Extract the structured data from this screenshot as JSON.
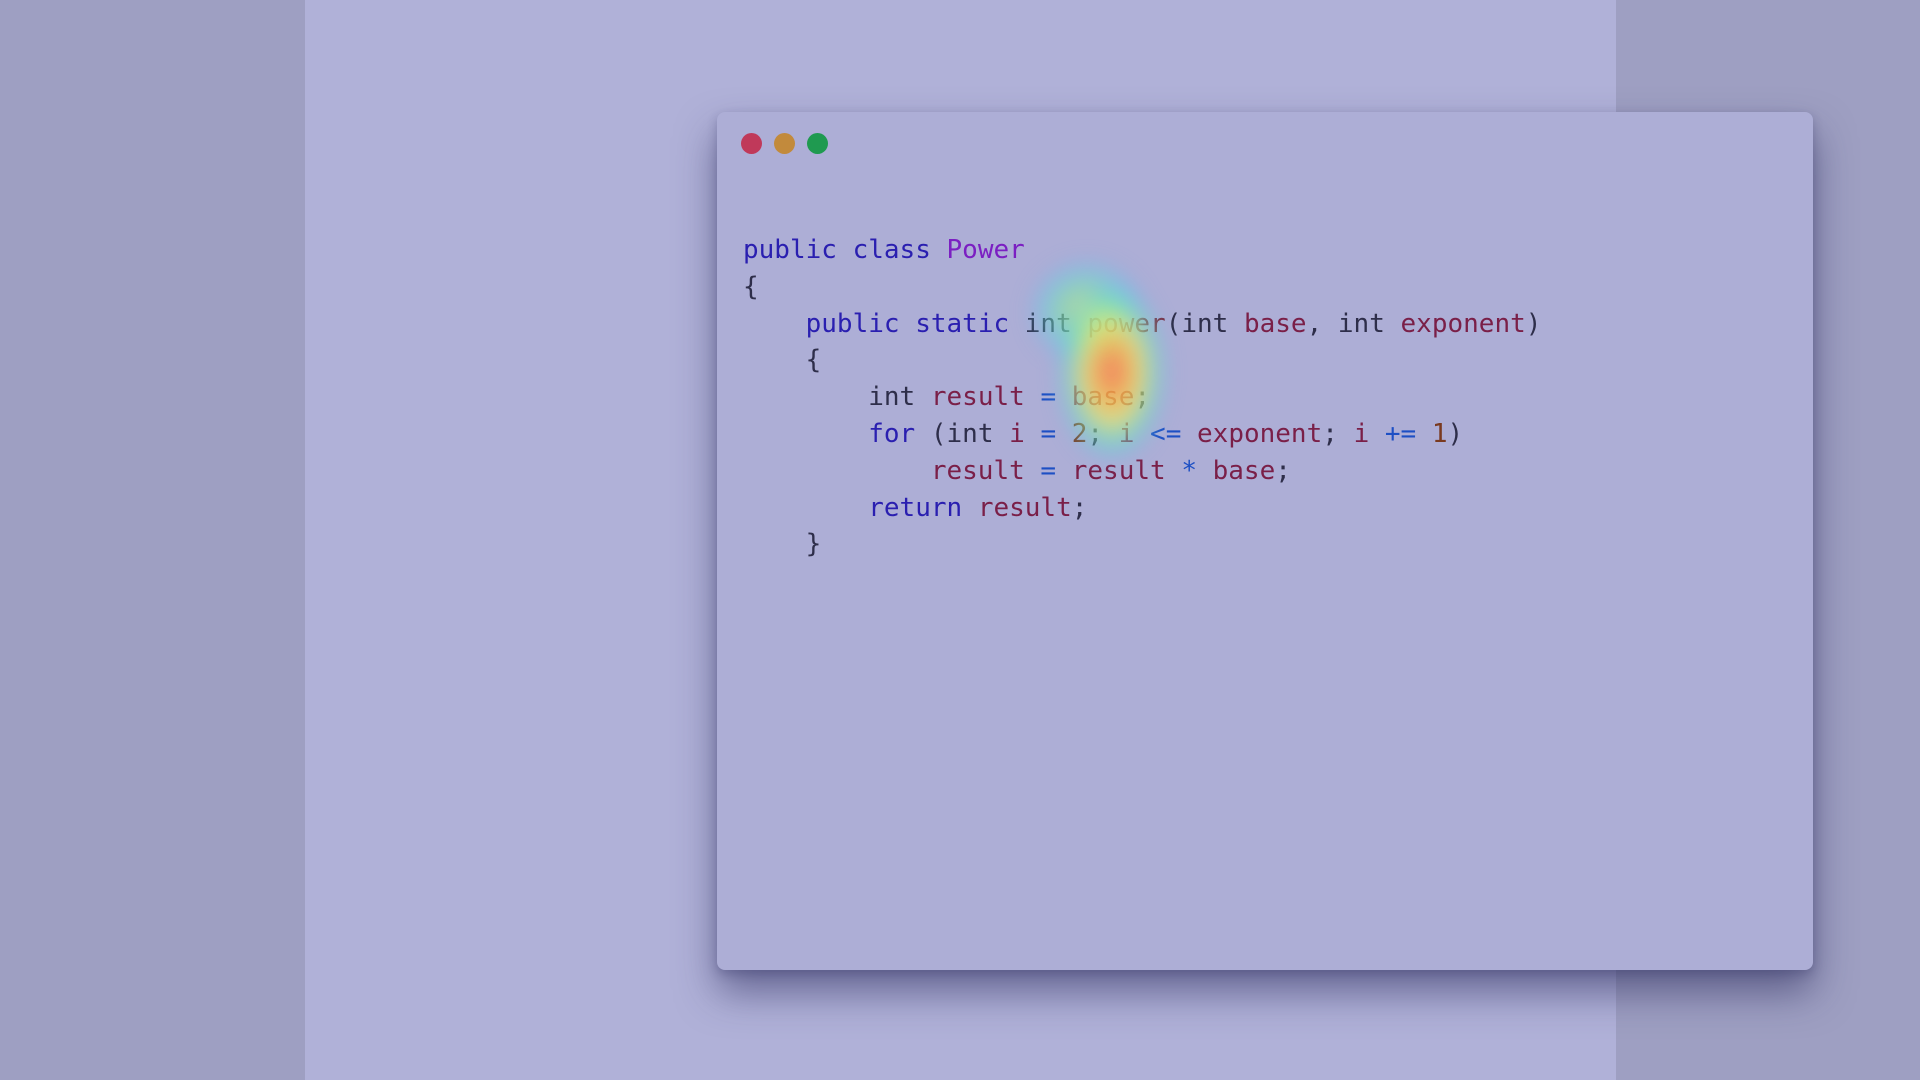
{
  "window": {
    "controls": [
      {
        "name": "close",
        "color": "#c0395a"
      },
      {
        "name": "minimize",
        "color": "#c28a3c"
      },
      {
        "name": "maximize",
        "color": "#1f9a50"
      }
    ]
  },
  "editor": {
    "lines": [
      [
        [
          "kw",
          "public"
        ],
        [
          "plain",
          " "
        ],
        [
          "kw",
          "class"
        ],
        [
          "plain",
          " "
        ],
        [
          "cls",
          "Power"
        ]
      ],
      [
        [
          "plain",
          "{"
        ]
      ],
      [
        [
          "plain",
          "    "
        ],
        [
          "kw",
          "public"
        ],
        [
          "plain",
          " "
        ],
        [
          "kw",
          "static"
        ],
        [
          "plain",
          " "
        ],
        [
          "plain",
          "int"
        ],
        [
          "plain",
          " "
        ],
        [
          "fn",
          "power"
        ],
        [
          "plain",
          "("
        ],
        [
          "plain",
          "int"
        ],
        [
          "plain",
          " "
        ],
        [
          "var",
          "base"
        ],
        [
          "plain",
          ", "
        ],
        [
          "plain",
          "int"
        ],
        [
          "plain",
          " "
        ],
        [
          "var",
          "exponent"
        ],
        [
          "plain",
          ")"
        ]
      ],
      [
        [
          "plain",
          "    {"
        ]
      ],
      [
        [
          "plain",
          "        "
        ],
        [
          "plain",
          "int"
        ],
        [
          "plain",
          " "
        ],
        [
          "var",
          "result"
        ],
        [
          "plain",
          " "
        ],
        [
          "op",
          "="
        ],
        [
          "plain",
          " "
        ],
        [
          "var",
          "base"
        ],
        [
          "plain",
          ";"
        ]
      ],
      [
        [
          "plain",
          "        "
        ],
        [
          "kw",
          "for"
        ],
        [
          "plain",
          " ("
        ],
        [
          "plain",
          "int"
        ],
        [
          "plain",
          " "
        ],
        [
          "var",
          "i"
        ],
        [
          "plain",
          " "
        ],
        [
          "op",
          "="
        ],
        [
          "plain",
          " "
        ],
        [
          "num",
          "2"
        ],
        [
          "plain",
          "; "
        ],
        [
          "var",
          "i"
        ],
        [
          "plain",
          " "
        ],
        [
          "op",
          "<="
        ],
        [
          "plain",
          " "
        ],
        [
          "var",
          "exponent"
        ],
        [
          "plain",
          "; "
        ],
        [
          "var",
          "i"
        ],
        [
          "plain",
          " "
        ],
        [
          "op",
          "+="
        ],
        [
          "plain",
          " "
        ],
        [
          "num",
          "1"
        ],
        [
          "plain",
          ")"
        ]
      ],
      [
        [
          "plain",
          "            "
        ],
        [
          "var",
          "result"
        ],
        [
          "plain",
          " "
        ],
        [
          "op",
          "="
        ],
        [
          "plain",
          " "
        ],
        [
          "var",
          "result"
        ],
        [
          "plain",
          " "
        ],
        [
          "op",
          "*"
        ],
        [
          "plain",
          " "
        ],
        [
          "var",
          "base"
        ],
        [
          "plain",
          ";"
        ]
      ],
      [
        [
          "plain",
          "        "
        ],
        [
          "kw",
          "return"
        ],
        [
          "plain",
          " "
        ],
        [
          "var",
          "result"
        ],
        [
          "plain",
          ";"
        ]
      ],
      [
        [
          "plain",
          "    }"
        ]
      ]
    ]
  },
  "heatmap": {
    "colors": [
      "#ff5a4a",
      "#ffb43c",
      "#f5f06a",
      "#7de8a0",
      "#5ad8f0",
      "#6a8cf0"
    ]
  }
}
